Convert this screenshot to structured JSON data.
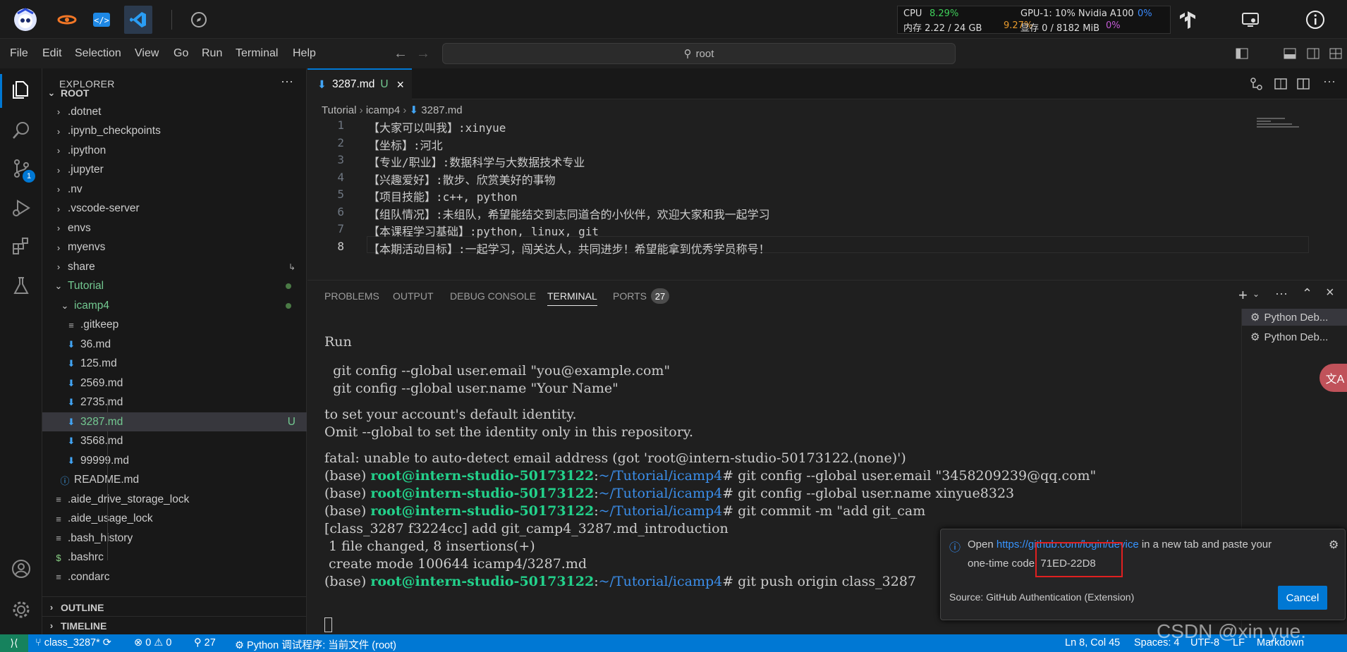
{
  "stats": {
    "cpu_label": "CPU",
    "cpu_value": "8.29%",
    "mem_label": "内存 2.22 / 24 GB",
    "mem_value": "9.27%",
    "gpu_label": "GPU-1: 10% Nvidia A100",
    "gpu_value": "0%",
    "vram_label": "显存 0 / 8182 MiB",
    "vram_value": "0%"
  },
  "menu": [
    "File",
    "Edit",
    "Selection",
    "View",
    "Go",
    "Run",
    "Terminal",
    "Help"
  ],
  "command_center": "root",
  "source_control_badge": "1",
  "sidebar": {
    "title": "EXPLORER",
    "root": "ROOT",
    "items": [
      {
        "label": ".dotnet",
        "kind": "folder"
      },
      {
        "label": ".ipynb_checkpoints",
        "kind": "folder"
      },
      {
        "label": ".ipython",
        "kind": "folder"
      },
      {
        "label": ".jupyter",
        "kind": "folder"
      },
      {
        "label": ".nv",
        "kind": "folder"
      },
      {
        "label": ".vscode-server",
        "kind": "folder"
      },
      {
        "label": "envs",
        "kind": "folder"
      },
      {
        "label": "myenvs",
        "kind": "folder"
      },
      {
        "label": "share",
        "kind": "folder"
      },
      {
        "label": "Tutorial",
        "kind": "folder-open"
      },
      {
        "label": "icamp4",
        "kind": "folder-open"
      },
      {
        "label": ".gitkeep",
        "kind": "file"
      },
      {
        "label": "36.md",
        "kind": "md"
      },
      {
        "label": "125.md",
        "kind": "md"
      },
      {
        "label": "2569.md",
        "kind": "md"
      },
      {
        "label": "2735.md",
        "kind": "md"
      },
      {
        "label": "3287.md",
        "kind": "md",
        "badge": "U"
      },
      {
        "label": "3568.md",
        "kind": "md"
      },
      {
        "label": "99999.md",
        "kind": "md"
      },
      {
        "label": "README.md",
        "kind": "info"
      },
      {
        "label": ".aide_drive_storage_lock",
        "kind": "file"
      },
      {
        "label": ".aide_usage_lock",
        "kind": "file"
      },
      {
        "label": ".bash_history",
        "kind": "file"
      },
      {
        "label": ".bashrc",
        "kind": "dollar"
      },
      {
        "label": ".condarc",
        "kind": "file"
      }
    ],
    "outline": "OUTLINE",
    "timeline": "TIMELINE"
  },
  "editor": {
    "tab_label": "3287.md",
    "tab_badge": "U",
    "breadcrumb": [
      "Tutorial",
      "icamp4",
      "3287.md"
    ],
    "lines": [
      "【大家可以叫我】:xinyue",
      "【坐标】:河北",
      "【专业/职业】:数据科学与大数据技术专业",
      "【兴趣爱好】:散步、欣赏美好的事物",
      "【项目技能】:c++, python",
      "【组队情况】:未组队，希望能结交到志同道合的小伙伴，欢迎大家和我一起学习",
      "【本课程学习基础】:python, linux, git",
      "【本期活动目标】:一起学习，闯关达人，共同进步！希望能拿到优秀学员称号！"
    ]
  },
  "panel": {
    "tabs": [
      "PROBLEMS",
      "OUTPUT",
      "DEBUG CONSOLE",
      "TERMINAL",
      "PORTS"
    ],
    "ports_count": "27",
    "terminals": [
      "Python Deb...",
      "Python Deb..."
    ],
    "term": {
      "l1": "Run",
      "l2": "  git config --global user.email \"you@example.com\"",
      "l3": "  git config --global user.name \"Your Name\"",
      "l4": "to set your account's default identity.",
      "l5": "Omit --global to set the identity only in this repository.",
      "l6": "fatal: unable to auto-detect email address (got 'root@intern-studio-50173122.(none)')",
      "base": "(base) ",
      "user": "root@intern-studio-50173122",
      "path": "~/Tutorial/icamp4",
      "cmd1": "# git config --global user.email \"3458209239@qq.com\"",
      "cmd2": "# git config --global user.name xinyue8323",
      "cmd3": "# git commit -m \"add git_cam",
      "l10": "[class_3287 f3224cc] add git_camp4_3287.md_introduction",
      "l11": " 1 file changed, 8 insertions(+)",
      "l12": " create mode 100644 icamp4/3287.md",
      "cmd4": "# git push origin class_3287"
    }
  },
  "notification": {
    "open": "Open",
    "link": "https://github.com/login/device",
    "rest": "in a new tab and paste your",
    "line2": "one-time code: 71ED-22D8",
    "source": "Source: GitHub Authentication (Extension)",
    "cancel": "Cancel"
  },
  "status": {
    "branch": "class_3287*",
    "errors": "0",
    "warnings": "0",
    "ports": "27",
    "debug": "Python 调试程序: 当前文件 (root)",
    "position": "Ln 8, Col 45",
    "spaces": "Spaces: 4",
    "encoding": "UTF-8",
    "eol": "LF",
    "language": "Markdown"
  },
  "watermark": "CSDN @xin yue.",
  "colors": {
    "accent": "#0078d4",
    "status_bar": "#0078d4",
    "terminal_green": "#23d18b",
    "terminal_blue": "#3b8eea",
    "highlight_box": "#e02020"
  }
}
